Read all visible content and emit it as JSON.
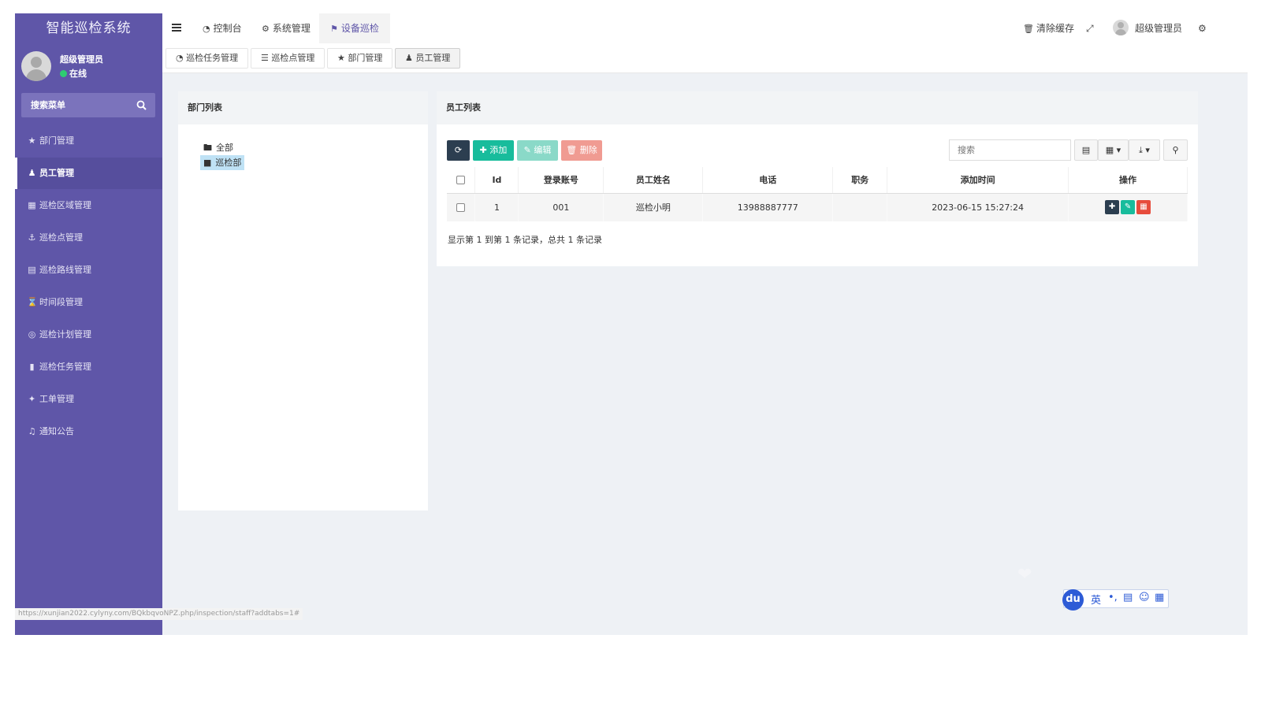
{
  "app": {
    "title": "智能巡检系统"
  },
  "user": {
    "name": "超级管理员",
    "status": "在线"
  },
  "sidebar": {
    "search_placeholder": "搜索菜单",
    "items": [
      {
        "label": "部门管理",
        "icon": "users-icon"
      },
      {
        "label": "员工管理",
        "icon": "user-icon",
        "active": true
      },
      {
        "label": "巡检区域管理",
        "icon": "grid-icon"
      },
      {
        "label": "巡检点管理",
        "icon": "anchor-icon"
      },
      {
        "label": "巡检路线管理",
        "icon": "map-icon"
      },
      {
        "label": "时间段管理",
        "icon": "hourglass-icon"
      },
      {
        "label": "巡检计划管理",
        "icon": "eye-icon"
      },
      {
        "label": "巡检任务管理",
        "icon": "bookmark-icon"
      },
      {
        "label": "工单管理",
        "icon": "crosshair-icon"
      },
      {
        "label": "通知公告",
        "icon": "bell-icon"
      }
    ]
  },
  "navbar": {
    "tabs": [
      {
        "label": "控制台",
        "icon": "dashboard-icon"
      },
      {
        "label": "系统管理",
        "icon": "cogs-icon"
      },
      {
        "label": "设备巡检",
        "icon": "flag-icon",
        "active": true
      }
    ],
    "clear_cache": "清除缓存",
    "user": "超级管理员"
  },
  "subtabs": [
    {
      "label": "巡检任务管理",
      "icon": "dashboard-icon"
    },
    {
      "label": "巡检点管理",
      "icon": "list-icon"
    },
    {
      "label": "部门管理",
      "icon": "users-icon"
    },
    {
      "label": "员工管理",
      "icon": "user-icon",
      "active": true
    }
  ],
  "dept_panel": {
    "title": "部门列表",
    "tree": [
      {
        "label": "全部",
        "selected": false
      },
      {
        "label": "巡检部",
        "selected": true
      }
    ]
  },
  "staff_panel": {
    "title": "员工列表",
    "buttons": {
      "refresh": "",
      "add": "添加",
      "edit": "编辑",
      "delete": "删除"
    },
    "search_placeholder": "搜索",
    "columns": [
      "Id",
      "登录账号",
      "员工姓名",
      "电话",
      "职务",
      "添加时间",
      "操作"
    ],
    "rows": [
      {
        "id": "1",
        "account": "001",
        "name": "巡检小明",
        "phone": "13988887777",
        "position": "",
        "created": "2023-06-15 15:27:24"
      }
    ],
    "pager": "显示第 1 到第 1 条记录，总共 1 条记录"
  },
  "status_url": "https://xunjian2022.cylyny.com/BQkbqvoNPZ.php/inspection/staff?addtabs=1#",
  "ime": {
    "lang": "英"
  },
  "colors": {
    "sidebar": "#5f56a8",
    "primary_dark": "#2c3e50",
    "success": "#18bc9c",
    "danger": "#e74c3c",
    "info_blue": "#3c8dbc"
  }
}
